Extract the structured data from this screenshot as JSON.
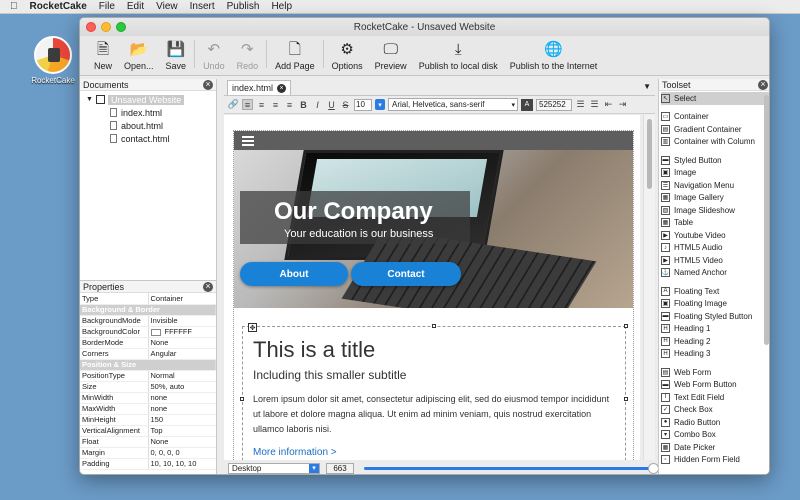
{
  "menubar": {
    "app": "RocketCake",
    "items": [
      "File",
      "Edit",
      "View",
      "Insert",
      "Publish",
      "Help"
    ]
  },
  "desktop": {
    "icon_label": "RocketCake"
  },
  "window": {
    "title": "RocketCake - Unsaved Website"
  },
  "toolbar": {
    "new": "New",
    "open": "Open...",
    "save": "Save",
    "undo": "Undo",
    "redo": "Redo",
    "add_page": "Add Page",
    "options": "Options",
    "preview": "Preview",
    "publish_local": "Publish to local disk",
    "publish_internet": "Publish to the Internet"
  },
  "documents": {
    "title": "Documents",
    "root": "Unsaved Website",
    "files": [
      "index.html",
      "about.html",
      "contact.html"
    ]
  },
  "properties": {
    "title": "Properties",
    "rows": [
      {
        "k": "Type",
        "v": "Container"
      },
      {
        "section": "Background & Border"
      },
      {
        "k": "BackgroundMode",
        "v": "Invisible"
      },
      {
        "k": "BackgroundColor",
        "v": "FFFFFF",
        "swatch": true
      },
      {
        "k": "BorderMode",
        "v": "None"
      },
      {
        "k": "Corners",
        "v": "Angular"
      },
      {
        "section": "Position & Size"
      },
      {
        "k": "PositionType",
        "v": "Normal"
      },
      {
        "k": "Size",
        "v": "50%, auto"
      },
      {
        "k": "MinWidth",
        "v": "none"
      },
      {
        "k": "MaxWidth",
        "v": "none"
      },
      {
        "k": "MinHeight",
        "v": "150"
      },
      {
        "k": "VerticalAlignment",
        "v": "Top"
      },
      {
        "k": "Float",
        "v": "None"
      },
      {
        "k": "Margin",
        "v": "0, 0, 0, 0"
      },
      {
        "k": "Padding",
        "v": "10, 10, 10, 10"
      }
    ]
  },
  "editor": {
    "tab": "index.html",
    "font_size": "10",
    "font_family": "Arial, Helvetica, sans-serif",
    "text_color": "525252",
    "device": "Desktop",
    "width": "663"
  },
  "page": {
    "hero_title": "Our Company",
    "hero_subtitle": "Your education is our business",
    "btn_about": "About",
    "btn_contact": "Contact",
    "title": "This is a title",
    "subtitle": "Including this smaller subtitle",
    "body": "Lorem ipsum dolor sit amet, consectetur adipiscing elit, sed do eiusmod tempor incididunt ut labore et dolore magna aliqua. Ut enim ad minim veniam, quis nostrud exercitation ullamco laboris nisi.",
    "link": "More information >"
  },
  "toolset": {
    "title": "Toolset",
    "groups": [
      [
        {
          "label": "Select",
          "icon": "cursor-icon",
          "selected": true
        }
      ],
      [
        {
          "label": "Container",
          "icon": "container-icon"
        },
        {
          "label": "Gradient Container",
          "icon": "gradient-container-icon"
        },
        {
          "label": "Container with Column",
          "icon": "column-container-icon"
        }
      ],
      [
        {
          "label": "Styled Button",
          "icon": "button-icon"
        },
        {
          "label": "Image",
          "icon": "image-icon"
        },
        {
          "label": "Navigation Menu",
          "icon": "menu-icon"
        },
        {
          "label": "Image Gallery",
          "icon": "gallery-icon"
        },
        {
          "label": "Image Slideshow",
          "icon": "slideshow-icon"
        },
        {
          "label": "Table",
          "icon": "table-icon"
        },
        {
          "label": "Youtube Video",
          "icon": "video-icon"
        },
        {
          "label": "HTML5 Audio",
          "icon": "audio-icon"
        },
        {
          "label": "HTML5 Video",
          "icon": "html5-video-icon"
        },
        {
          "label": "Named Anchor",
          "icon": "anchor-icon"
        }
      ],
      [
        {
          "label": "Floating Text",
          "icon": "text-icon"
        },
        {
          "label": "Floating Image",
          "icon": "floating-image-icon"
        },
        {
          "label": "Floating Styled Button",
          "icon": "floating-button-icon"
        },
        {
          "label": "Heading 1",
          "icon": "heading1-icon"
        },
        {
          "label": "Heading 2",
          "icon": "heading2-icon"
        },
        {
          "label": "Heading 3",
          "icon": "heading3-icon"
        }
      ],
      [
        {
          "label": "Web Form",
          "icon": "form-icon"
        },
        {
          "label": "Web Form Button",
          "icon": "form-button-icon"
        },
        {
          "label": "Text Edit Field",
          "icon": "text-field-icon"
        },
        {
          "label": "Check Box",
          "icon": "checkbox-icon"
        },
        {
          "label": "Radio Button",
          "icon": "radio-icon"
        },
        {
          "label": "Combo Box",
          "icon": "combobox-icon"
        },
        {
          "label": "Date Picker",
          "icon": "date-picker-icon"
        },
        {
          "label": "Hidden Form Field",
          "icon": "hidden-field-icon"
        }
      ]
    ]
  }
}
